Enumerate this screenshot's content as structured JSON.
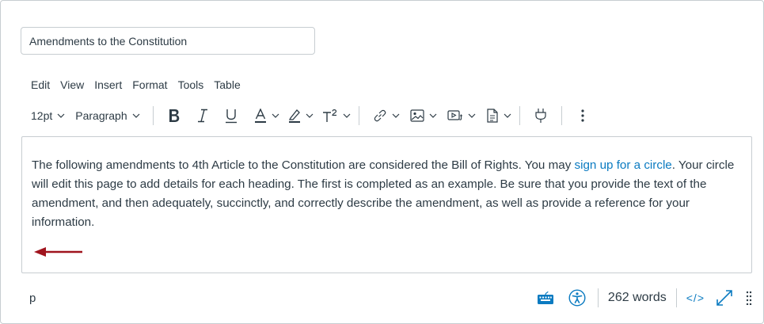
{
  "title_input": {
    "value": "Amendments to the Constitution"
  },
  "menubar": {
    "items": [
      "Edit",
      "View",
      "Insert",
      "Format",
      "Tools",
      "Table"
    ]
  },
  "toolbar": {
    "font_size": "12pt",
    "block_format": "Paragraph",
    "icons": [
      "bold-icon",
      "italic-icon",
      "underline-icon",
      "text-color-icon",
      "highlight-icon",
      "superscript-icon",
      "link-icon",
      "image-icon",
      "media-icon",
      "document-icon",
      "plugin-icon",
      "more-icon"
    ]
  },
  "editor": {
    "text_before_link": "The following amendments to 4th Article to the Constitution are considered the Bill of Rights. You may ",
    "link_text": "sign up for a circle",
    "text_after_link": ". Your circle will edit this page to add details for each heading. The first is completed as an example. Be sure that you provide the text of the amendment, and then adequately, succinctly, and correctly describe the amendment, as well as provide a reference for your information."
  },
  "statusbar": {
    "path": "p",
    "word_count": "262 words",
    "html_toggle": "</>"
  },
  "colors": {
    "accent": "#0b7bc1",
    "arrow": "#a0141e",
    "text": "#2d3b45",
    "border": "#c7cdd1"
  }
}
